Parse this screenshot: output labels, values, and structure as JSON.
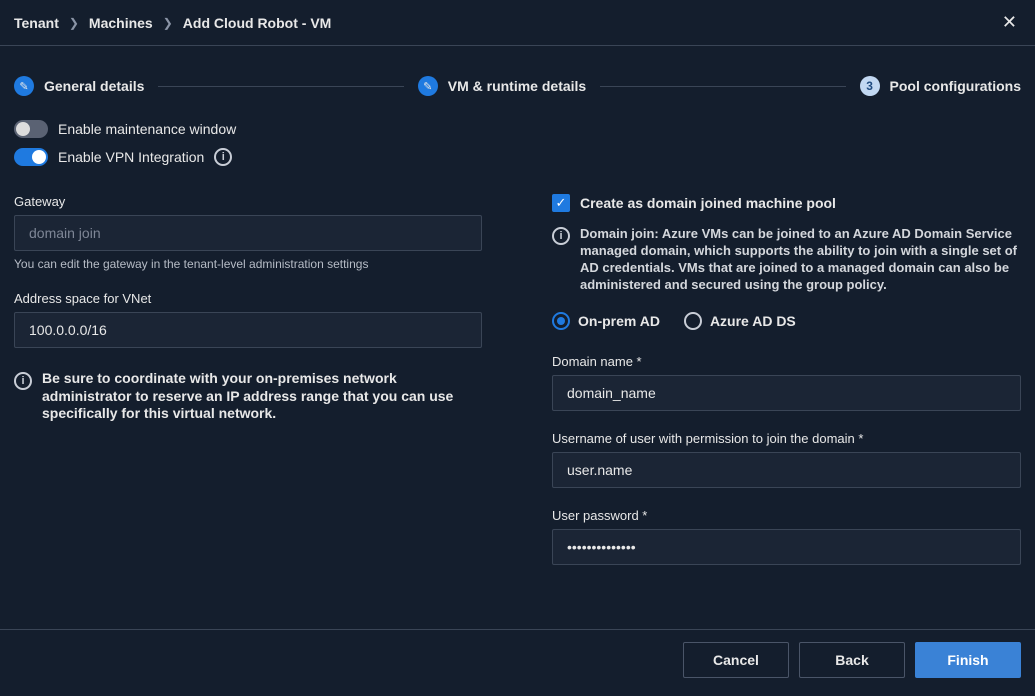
{
  "breadcrumb": {
    "items": [
      "Tenant",
      "Machines",
      "Add Cloud Robot - VM"
    ]
  },
  "stepper": {
    "step1": "General details",
    "step2": "VM & runtime details",
    "step3": "Pool configurations",
    "step3_num": "3"
  },
  "toggles": {
    "maintenance_label": "Enable maintenance window",
    "maintenance_on": false,
    "vpn_label": "Enable VPN Integration",
    "vpn_on": true
  },
  "left": {
    "gateway_label": "Gateway",
    "gateway_value": "domain join",
    "gateway_helper": "You can edit the gateway in the tenant-level administration settings",
    "address_label": "Address space for VNet",
    "address_value": "100.0.0.0/16",
    "coord_note": "Be sure to coordinate with your on-premises network administrator to reserve an IP address range that you can use specifically for this virtual network."
  },
  "right": {
    "create_domain_label": "Create as domain joined machine pool",
    "domain_join_note": "Domain join: Azure VMs can be joined to an Azure AD Domain Service managed domain, which supports the ability to join with a single set of AD credentials. VMs that are joined to a managed domain can also be administered and secured using the group policy.",
    "radio_onprem": "On-prem AD",
    "radio_azure": "Azure AD DS",
    "domain_name_label": "Domain name *",
    "domain_name_value": "domain_name",
    "username_label": "Username of user with permission to join the domain *",
    "username_value": "user.name",
    "password_label": "User password *",
    "password_value": "••••••••••••••"
  },
  "footer": {
    "cancel": "Cancel",
    "back": "Back",
    "finish": "Finish"
  }
}
